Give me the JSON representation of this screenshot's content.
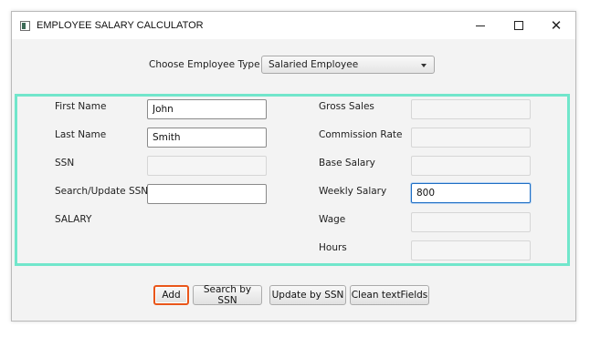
{
  "window": {
    "title": "EMPLOYEE SALARY CALCULATOR",
    "controls": {
      "minimize_icon": "minimize-icon",
      "maximize_icon": "maximize-icon",
      "close_icon": "close-icon",
      "close_glyph": "✕"
    }
  },
  "employee_type": {
    "label": "Choose Employee Type",
    "selected": "Salaried Employee"
  },
  "form": {
    "left": {
      "first_name": {
        "label": "First Name",
        "value": "John"
      },
      "last_name": {
        "label": "Last Name",
        "value": "Smith"
      },
      "ssn": {
        "label": "SSN",
        "value": ""
      },
      "search_ssn": {
        "label": "Search/Update SSN",
        "value": ""
      },
      "salary": {
        "label": "SALARY"
      }
    },
    "right": {
      "gross_sales": {
        "label": "Gross Sales",
        "value": ""
      },
      "commission_rate": {
        "label": "Commission Rate",
        "value": ""
      },
      "base_salary": {
        "label": "Base Salary",
        "value": ""
      },
      "weekly_salary": {
        "label": "Weekly Salary",
        "value": "800"
      },
      "wage": {
        "label": "Wage",
        "value": ""
      },
      "hours": {
        "label": "Hours",
        "value": ""
      }
    }
  },
  "buttons": {
    "add": "Add",
    "search_by_ssn": "Search by SSN",
    "update_by_ssn": "Update by SSN",
    "clean_textfields": "Clean textFields"
  },
  "colors": {
    "panel_border": "#71e6cb",
    "focus_ring": "#e9561a",
    "input_focus": "#1f6fc4"
  }
}
